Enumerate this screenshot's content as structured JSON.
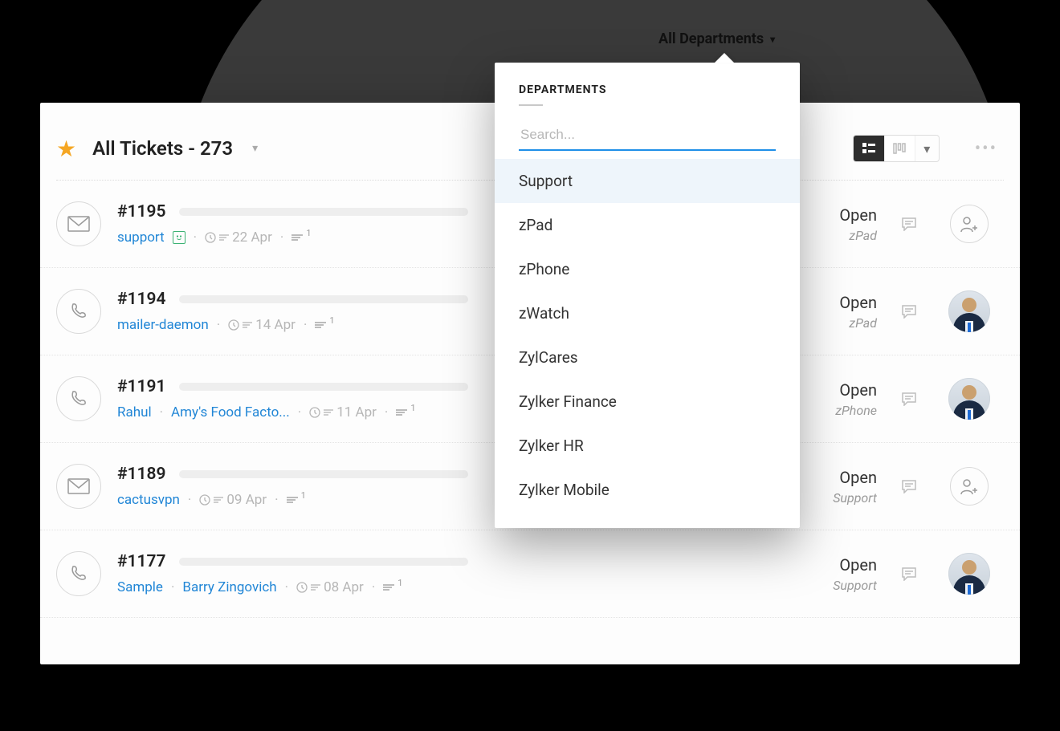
{
  "dropdown": {
    "trigger": "All Departments",
    "heading": "DEPARTMENTS",
    "search_placeholder": "Search...",
    "items": [
      "Support",
      "zPad",
      "zPhone",
      "zWatch",
      "ZylCares",
      "Zylker Finance",
      "Zylker HR",
      "Zylker Mobile"
    ],
    "selected": "Support"
  },
  "header": {
    "title": "All Tickets - 273"
  },
  "tickets": [
    {
      "id": "#1195",
      "channel": "email",
      "contact": "support",
      "company": null,
      "has_sentiment": true,
      "date": "22 Apr",
      "threads": "1",
      "status": "Open",
      "department": "zPad",
      "assignee": "unassigned"
    },
    {
      "id": "#1194",
      "channel": "phone",
      "contact": "mailer-daemon",
      "company": null,
      "has_sentiment": false,
      "date": "14 Apr",
      "threads": "1",
      "status": "Open",
      "department": "zPad",
      "assignee": "avatar"
    },
    {
      "id": "#1191",
      "channel": "phone",
      "contact": "Rahul",
      "company": "Amy's Food Facto...",
      "has_sentiment": false,
      "date": "11 Apr",
      "threads": "1",
      "status": "Open",
      "department": "zPhone",
      "assignee": "avatar"
    },
    {
      "id": "#1189",
      "channel": "email",
      "contact": "cactusvpn",
      "company": null,
      "has_sentiment": false,
      "date": "09 Apr",
      "threads": "1",
      "status": "Open",
      "department": "Support",
      "assignee": "unassigned"
    },
    {
      "id": "#1177",
      "channel": "phone",
      "contact": "Sample",
      "company": "Barry Zingovich",
      "has_sentiment": false,
      "date": "08 Apr",
      "threads": "1",
      "status": "Open",
      "department": "Support",
      "assignee": "avatar"
    }
  ]
}
